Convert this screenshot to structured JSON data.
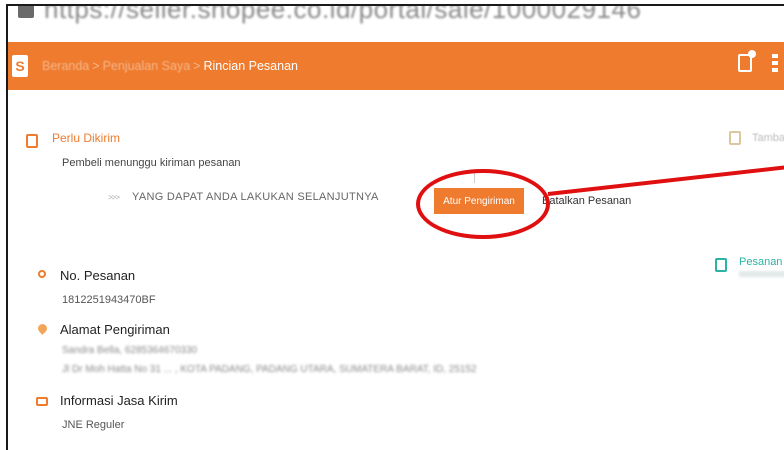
{
  "browser": {
    "url": "https://seller.shopee.co.id/portal/sale/1000029146"
  },
  "header": {
    "breadcrumbs": [
      "Beranda",
      "Penjualan Saya",
      "Rincian Pesanan"
    ],
    "separator": ">",
    "brand_color": "#ee7b2e"
  },
  "status": {
    "title": "Perlu Dikirim",
    "description": "Pembeli menunggu kiriman pesanan"
  },
  "next_steps": {
    "arrows": ">>>",
    "label": "YANG DAPAT ANDA LAKUKAN SELANJUTNYA",
    "primary_button": "Atur Pengiriman",
    "secondary_button": "Batalkan Pesanan"
  },
  "right_panel": {
    "add_note": "Tambahkan Catatan",
    "order_history_title": "Pesanan B"
  },
  "order": {
    "label": "No. Pesanan",
    "number": "1812251943470BF"
  },
  "shipping_address": {
    "label": "Alamat Pengiriman",
    "recipient": "Sandra Bella, 6285364670330",
    "address": "Jl Dr Moh Hatta No 31 ... , KOTA PADANG, PADANG UTARA, SUMATERA BARAT, ID, 25152"
  },
  "courier": {
    "label": "Informasi Jasa Kirim",
    "name": "JNE Reguler"
  },
  "annotation": {
    "color": "#e01010"
  }
}
